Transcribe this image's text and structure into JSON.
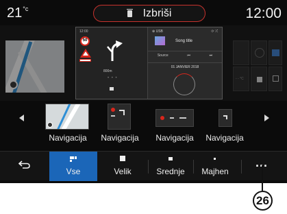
{
  "status_bar": {
    "temperature": "21",
    "temperature_unit": "°c",
    "clock": "12:00",
    "delete_label": "Izbriši"
  },
  "widgets": {
    "nav_time": "12:00",
    "speed_limit": "50",
    "distance": "800m",
    "music_source": "USB",
    "song_title": "Song title",
    "source_label": "Source",
    "date": "01 JANVIER 2018",
    "weather_temp": "- - °C"
  },
  "carousel": {
    "items": [
      {
        "label": "Navigacija"
      },
      {
        "label": "Navigacija"
      },
      {
        "label": "Navigacija"
      },
      {
        "label": "Navigacija"
      }
    ]
  },
  "tabbar": {
    "tabs": [
      {
        "label": "Vse",
        "active": true
      },
      {
        "label": "Velik"
      },
      {
        "label": "Srednje"
      },
      {
        "label": "Majhen"
      }
    ],
    "more_label": "..."
  },
  "callout": {
    "number": "26"
  },
  "colors": {
    "accent": "#1b66b8",
    "delete_border": "#c8322d",
    "background": "#0b0b0b"
  }
}
